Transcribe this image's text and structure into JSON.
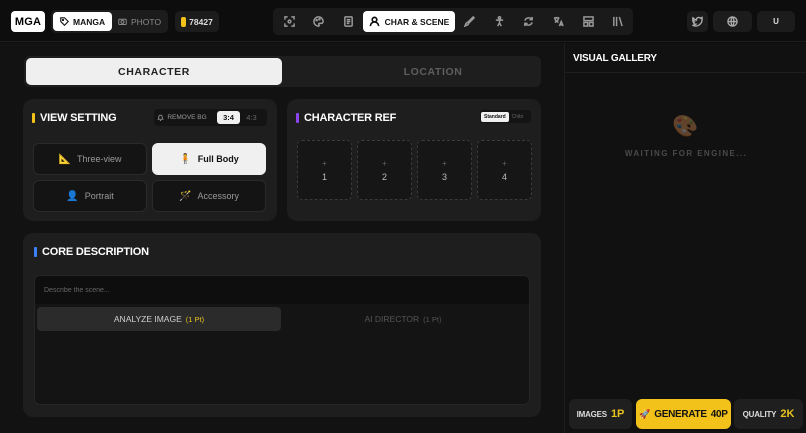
{
  "topbar": {
    "logo": "MGA",
    "modes": [
      {
        "label": "MANGA",
        "icon": "tag-icon",
        "active": true
      },
      {
        "label": "PHOTO",
        "icon": "camera-icon",
        "active": false
      }
    ],
    "credits": "78427",
    "tools": [
      {
        "name": "scan-tool",
        "icon": "scan-icon"
      },
      {
        "name": "palette-tool",
        "icon": "palette-icon"
      },
      {
        "name": "book-tool",
        "icon": "book-icon"
      },
      {
        "name": "brush-tool",
        "icon": "brush-icon"
      },
      {
        "name": "pose-tool",
        "icon": "figure-icon"
      },
      {
        "name": "refresh-tool",
        "icon": "refresh-icon"
      },
      {
        "name": "translate-tool",
        "icon": "translate-icon"
      },
      {
        "name": "layout-tool",
        "icon": "layout-icon"
      },
      {
        "name": "library-tool",
        "icon": "library-icon"
      }
    ],
    "active_tool": "CHAR & SCENE",
    "user_initial": "U"
  },
  "tabs": [
    {
      "label": "CHARACTER",
      "active": true
    },
    {
      "label": "LOCATION",
      "active": false
    }
  ],
  "view_setting": {
    "title": "VIEW SETTING",
    "accent": "#f2c21a",
    "remove_bg": "REMOVE BG",
    "ratios": [
      "3:4",
      "4:3"
    ],
    "selected_ratio": "3:4",
    "options": [
      {
        "label": "Three-view",
        "icon": "triangle-ruler-icon",
        "glyph": "📐",
        "active": false
      },
      {
        "label": "Full Body",
        "icon": "person-standing-icon",
        "glyph": "🧍",
        "active": true
      },
      {
        "label": "Portrait",
        "icon": "bust-icon",
        "glyph": "👤",
        "active": false
      },
      {
        "label": "Accessory",
        "icon": "magic-wand-icon",
        "glyph": "🪄",
        "active": false
      }
    ]
  },
  "character_ref": {
    "title": "CHARACTER REF",
    "accent": "#8e44ec",
    "styles": [
      "Standard",
      "Chibi"
    ],
    "selected_style": "Standard",
    "slots": [
      "1",
      "2",
      "3",
      "4"
    ],
    "slot_plus": "+"
  },
  "core_description": {
    "title": "CORE DESCRIPTION",
    "accent": "#3b82f6",
    "placeholder": "Describe the scene...",
    "analyze_label": "ANALYZE IMAGE",
    "analyze_cost": "(1 Pt)",
    "director_label": "AI DIRECTOR",
    "director_cost": "(1 Pt)"
  },
  "gallery": {
    "title": "VISUAL GALLERY",
    "waiting": "WAITING FOR ENGINE...",
    "images_label": "IMAGES",
    "images_value": "1P",
    "generate_label": "GENERATE",
    "generate_cost": "40P",
    "quality_label": "QUALITY",
    "quality_value": "2K"
  }
}
